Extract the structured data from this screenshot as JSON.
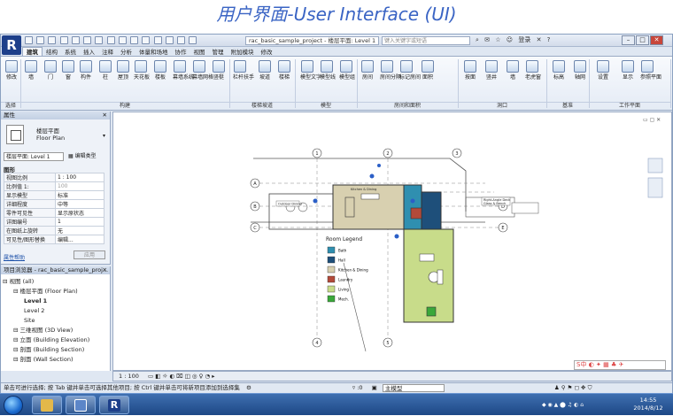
{
  "slide": {
    "title": "用户界面-User Interface (UI)"
  },
  "app": {
    "logo": "R",
    "document_title": "rac_basic_sample_project - 楼层平面: Level 1",
    "search_placeholder": "键入关键字或短语",
    "user_label": "登录",
    "help": "?",
    "tabs": [
      "建筑",
      "结构",
      "系统",
      "插入",
      "注释",
      "分析",
      "体量和场地",
      "协作",
      "视图",
      "管理",
      "附加模块",
      "修改"
    ],
    "active_tab": "建筑",
    "ribbon": {
      "buttons": [
        {
          "label": "修改",
          "icon": "cursor-icon"
        },
        {
          "label": "墙",
          "icon": "wall-icon"
        },
        {
          "label": "门",
          "icon": "door-icon"
        },
        {
          "label": "窗",
          "icon": "window-icon"
        },
        {
          "label": "构件",
          "icon": "component-icon"
        },
        {
          "label": "柱",
          "icon": "column-icon"
        },
        {
          "label": "屋顶",
          "icon": "roof-icon"
        },
        {
          "label": "天花板",
          "icon": "ceiling-icon"
        },
        {
          "label": "楼板",
          "icon": "floor-icon"
        },
        {
          "label": "幕墙系统",
          "icon": "curtain-system-icon"
        },
        {
          "label": "幕墙网格",
          "icon": "curtain-grid-icon"
        },
        {
          "label": "竖梃",
          "icon": "mullion-icon"
        },
        {
          "label": "栏杆扶手",
          "icon": "railing-icon"
        },
        {
          "label": "坡道",
          "icon": "ramp-icon"
        },
        {
          "label": "楼梯",
          "icon": "stair-icon"
        },
        {
          "label": "模型文字",
          "icon": "model-text-icon"
        },
        {
          "label": "模型线",
          "icon": "model-line-icon"
        },
        {
          "label": "模型组",
          "icon": "model-group-icon"
        },
        {
          "label": "房间",
          "icon": "room-icon"
        },
        {
          "label": "房间分隔",
          "icon": "room-separator-icon"
        },
        {
          "label": "标记房间",
          "icon": "tag-room-icon"
        },
        {
          "label": "面积",
          "icon": "area-icon"
        },
        {
          "label": "按面",
          "icon": "by-face-icon"
        },
        {
          "label": "竖井",
          "icon": "shaft-icon"
        },
        {
          "label": "墙",
          "icon": "opening-wall-icon"
        },
        {
          "label": "老虎窗",
          "icon": "dormer-icon"
        },
        {
          "label": "标高",
          "icon": "level-icon"
        },
        {
          "label": "轴网",
          "icon": "grid-icon"
        },
        {
          "label": "设置",
          "icon": "set-icon"
        },
        {
          "label": "显示",
          "icon": "show-icon"
        },
        {
          "label": "参照平面",
          "icon": "ref-plane-icon"
        },
        {
          "label": "查看器",
          "icon": "viewer-icon"
        }
      ],
      "groups": [
        "选择",
        "构建",
        "楼梯坡道",
        "模型",
        "房间和面积",
        "洞口",
        "基准",
        "工作平面"
      ]
    },
    "properties": {
      "title": "属性",
      "type_name_1": "楼层平面",
      "type_name_2": "Floor Plan",
      "level_select": "楼层平面: Level 1",
      "edit_type": "编辑类型",
      "section": "图形",
      "rows": [
        {
          "key": "视图比例",
          "value": "1 : 100"
        },
        {
          "key": "比例值 1:",
          "value": "100"
        },
        {
          "key": "显示模型",
          "value": "标准"
        },
        {
          "key": "详细程度",
          "value": "中等"
        },
        {
          "key": "零件可见性",
          "value": "显示原状态"
        },
        {
          "key": "详图编号",
          "value": "1"
        },
        {
          "key": "在图纸上旋转",
          "value": "无"
        },
        {
          "key": "可见性/图形替换",
          "value": "编辑..."
        }
      ],
      "help_link": "属性帮助",
      "apply": "应用"
    },
    "browser": {
      "title": "项目浏览器 - rac_basic_sample_proj...",
      "tree": [
        {
          "label": "视图 (all)",
          "depth": 0
        },
        {
          "label": "楼层平面 (Floor Plan)",
          "depth": 1
        },
        {
          "label": "Level 1",
          "depth": 2
        },
        {
          "label": "Level 2",
          "depth": 2
        },
        {
          "label": "Site",
          "depth": 2
        },
        {
          "label": "三维视图 (3D View)",
          "depth": 1
        },
        {
          "label": "立面 (Building Elevation)",
          "depth": 1
        },
        {
          "label": "剖面 (Building Section)",
          "depth": 1
        },
        {
          "label": "剖面 (Wall Section)",
          "depth": 1
        }
      ]
    },
    "drawing": {
      "legend_title": "Room Legend",
      "legend": [
        {
          "label": "Bath",
          "color": "#2f8fb0"
        },
        {
          "label": "Hall",
          "color": "#1e4f7a"
        },
        {
          "label": "Kitchen & Dining",
          "color": "#d8d0b0"
        },
        {
          "label": "Laundry",
          "color": "#b34a3a"
        },
        {
          "label": "Living",
          "color": "#c8dc8a"
        },
        {
          "label": "Mech.",
          "color": "#3aa83a"
        }
      ],
      "tags": [
        "Outdoor Dining",
        "Kitchen & Dining",
        "Right-Angle Deck Glass & Bench"
      ],
      "grid_labels": [
        "A",
        "B",
        "C",
        "D",
        "E",
        "1",
        "2",
        "3",
        "4",
        "5"
      ]
    },
    "viewbar": {
      "scale": "1 : 100"
    },
    "status": {
      "message": "单击可进行选择; 按 Tab 键并单击可选择其他项目; 按 Ctrl 键并单击可将新项目添加到选择集",
      "coord": ":0",
      "model": "主模型"
    },
    "ime": "S中",
    "clock": {
      "time": "14:55",
      "date": "2014/8/12"
    }
  }
}
